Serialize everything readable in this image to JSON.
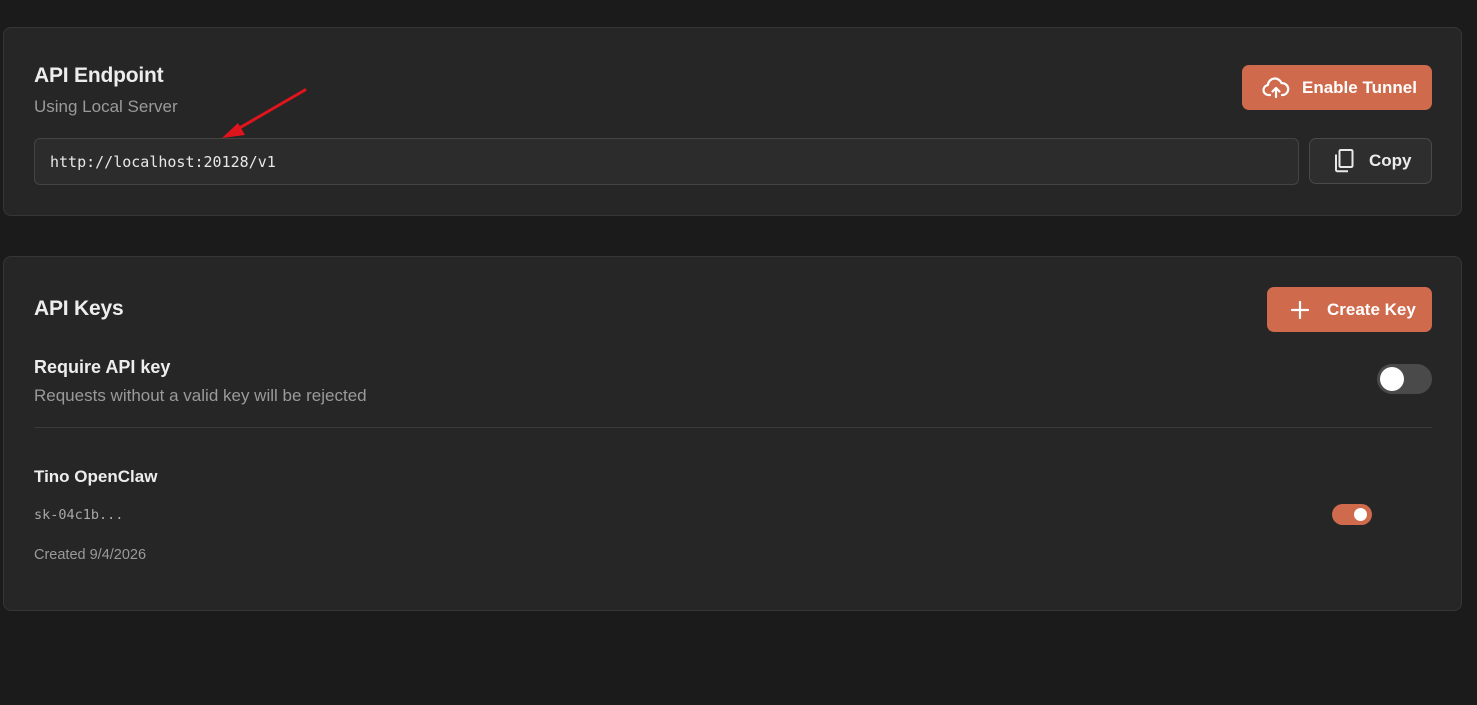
{
  "endpoint": {
    "title": "API Endpoint",
    "subtitle": "Using Local Server",
    "enable_tunnel_label": "Enable Tunnel",
    "url": "http://localhost:20128/v1",
    "copy_label": "Copy"
  },
  "keys": {
    "title": "API Keys",
    "create_key_label": "Create Key",
    "require": {
      "label": "Require API key",
      "description": "Requests without a valid key will be rejected",
      "enabled": false
    },
    "items": [
      {
        "name": "Tino OpenClaw",
        "key": "sk-04c1b...",
        "created": "Created 9/4/2026",
        "enabled": true
      }
    ]
  },
  "colors": {
    "accent": "#cf6a4c",
    "background": "#1b1b1b",
    "card": "#262626",
    "annotation_arrow": "#e0141c"
  },
  "icons": {
    "tunnel": "cloud-upload-icon",
    "copy": "copy-icon",
    "create": "plus-icon"
  }
}
